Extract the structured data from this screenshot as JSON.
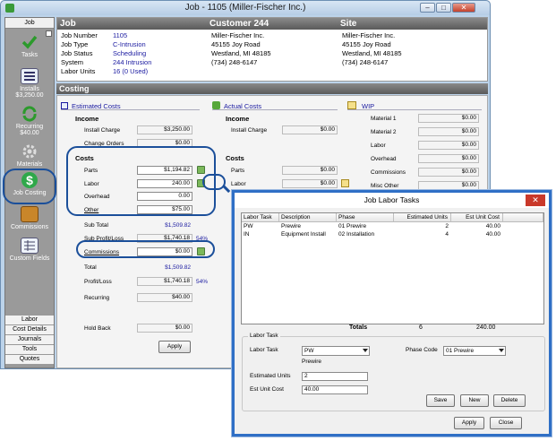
{
  "window": {
    "title": "Job - 1105 (Miller-Fischer Inc.)"
  },
  "sidebar": {
    "header": "Job",
    "items": [
      {
        "label": "Tasks",
        "icon": "checkmark-icon"
      },
      {
        "label": "Installs",
        "sub": "$3,250.00",
        "icon": "installs-icon"
      },
      {
        "label": "Recurring",
        "sub": "$40.00",
        "icon": "recurring-icon"
      },
      {
        "label": "Materials",
        "icon": "gear-icon"
      },
      {
        "label": "Job Costing",
        "icon": "dollar-icon"
      },
      {
        "label": "Commissions",
        "icon": "commissions-icon"
      },
      {
        "label": "Custom Fields",
        "icon": "custom-fields-icon"
      }
    ],
    "tabs": [
      "Labor",
      "Cost Details",
      "Journals",
      "Tools",
      "Quotes"
    ]
  },
  "header": {
    "col_job": "Job",
    "col_customer": "Customer 244",
    "col_site": "Site",
    "fields": [
      {
        "label": "Job Number",
        "value": "1105"
      },
      {
        "label": "Job Type",
        "value": "C-Intrusion"
      },
      {
        "label": "Job Status",
        "value": "Scheduling"
      },
      {
        "label": "System",
        "value": "244 Intrusion"
      },
      {
        "label": "Labor Units",
        "value": "16 (0 Used)"
      }
    ],
    "customer": [
      "Miller-Fischer Inc.",
      "45155 Joy Road",
      "Westland, MI 48185",
      "(734) 248-6147"
    ],
    "site": [
      "Miller-Fischer Inc.",
      "45155 Joy Road",
      "Westland, MI 48185",
      "(734) 248-6147"
    ]
  },
  "costing": {
    "title": "Costing",
    "estimated_title": "Estimated Costs",
    "actual_title": "Actual Costs",
    "wip_title": "WIP",
    "income": "Income",
    "costs": "Costs",
    "est": {
      "install_charge_lbl": "Install Charge",
      "install_charge": "$3,250.00",
      "change_orders_lbl": "Change Orders",
      "change_orders": "$0.00",
      "parts_lbl": "Parts",
      "parts": "$1,194.82",
      "labor_lbl": "Labor",
      "labor": "240.00",
      "overhead_lbl": "Overhead",
      "overhead": "0.00",
      "other_lbl": "Other",
      "other": "$75.00",
      "subtotal_lbl": "Sub Total",
      "subtotal": "$1,509.82",
      "subprofit_lbl": "Sub Profit/Loss",
      "subprofit": "$1,740.18",
      "subprofit_pct": "54%",
      "commissions_lbl": "Commissions",
      "commissions": "$0.00",
      "total_lbl": "Total",
      "total": "$1,509.82",
      "profit_lbl": "Profit/Loss",
      "profit": "$1,740.18",
      "profit_pct": "54%",
      "recurring_lbl": "Recurring",
      "recurring": "$40.00",
      "holdback_lbl": "Hold Back",
      "holdback": "$0.00"
    },
    "act": {
      "install_charge_lbl": "Install Charge",
      "install_charge": "$0.00",
      "parts_lbl": "Parts",
      "parts": "$0.00",
      "labor_lbl": "Labor",
      "labor": "$0.00"
    },
    "wip": [
      {
        "label": "Material 1",
        "value": "$0.00"
      },
      {
        "label": "Material 2",
        "value": "$0.00"
      },
      {
        "label": "Labor",
        "value": "$0.00"
      },
      {
        "label": "Overhead",
        "value": "$0.00"
      },
      {
        "label": "Commissions",
        "value": "$0.00"
      },
      {
        "label": "Misc Other",
        "value": "$0.00"
      }
    ],
    "apply": "Apply"
  },
  "dialog": {
    "title": "Job Labor Tasks",
    "close": "✕",
    "columns": [
      "Labor Task",
      "Description",
      "Phase",
      "Estimated Units",
      "Est Unit Cost"
    ],
    "rows": [
      {
        "task": "PW",
        "desc": "Prewire",
        "phase": "01 Prewire",
        "units": "2",
        "cost": "40.00"
      },
      {
        "task": "IN",
        "desc": "Equipment Install",
        "phase": "02 Installation",
        "units": "4",
        "cost": "40.00"
      }
    ],
    "totals_lbl": "Totals",
    "totals_units": "6",
    "totals_cost": "240.00",
    "group_title": "Labor Task",
    "labor_task_lbl": "Labor Task",
    "labor_task": "PW",
    "labor_task_desc": "Prewire",
    "phase_code_lbl": "Phase Code",
    "phase_code": "01 Prewire",
    "est_units_lbl": "Estimated Units",
    "est_units": "2",
    "est_cost_lbl": "Est Unit Cost",
    "est_cost": "40.00",
    "save": "Save",
    "new": "New",
    "delete": "Delete",
    "apply": "Apply",
    "close_btn": "Close"
  }
}
